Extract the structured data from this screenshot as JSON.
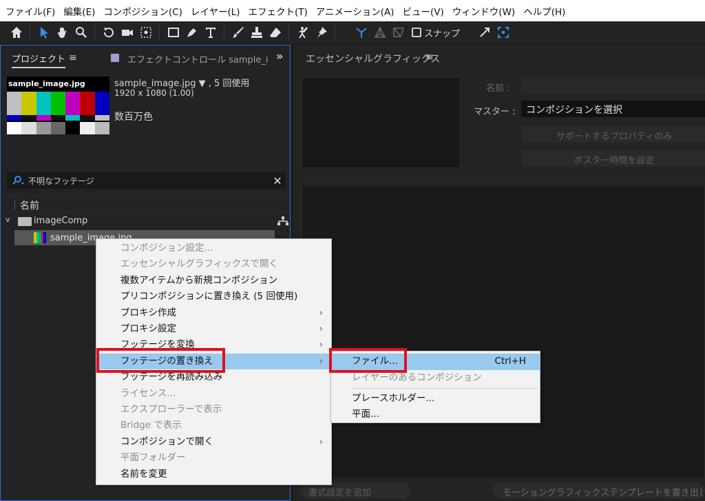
{
  "menubar": [
    "ファイル(F)",
    "編集(E)",
    "コンポジション(C)",
    "レイヤー(L)",
    "エフェクト(T)",
    "アニメーション(A)",
    "ビュー(V)",
    "ウィンドウ(W)",
    "ヘルプ(H)"
  ],
  "toolbar": {
    "tools": [
      "home-icon",
      "selection-arrow-icon",
      "hand-icon",
      "zoom-icon",
      "rotate-icon",
      "camera-icon",
      "pan-behind-icon",
      "rectangle-icon",
      "pen-icon",
      "text-icon",
      "brush-icon",
      "clone-stamp-icon",
      "eraser-icon",
      "roto-brush-icon",
      "puppet-pin-icon"
    ],
    "snap_label": "スナップ",
    "accent": "#3a8ee6"
  },
  "project": {
    "tab_label": "プロジェクト",
    "effect_tab_label": "エフェクトコントロール sample_i",
    "thumb_label": "sample_image.jpg",
    "file_line1": "sample_image.jpg ▼ , 5 回使用",
    "file_line2": "1920 x 1080 (1.00)",
    "file_line3": "数百万色",
    "search_value": "不明なフッテージ",
    "column_name": "名前",
    "folder_name": "imageComp",
    "item_name": "sample_image.jpg"
  },
  "essential": {
    "title": "エッセンシャルグラフィックス",
    "name_label": "名前 :",
    "master_label": "マスター :",
    "master_value": "コンポジションを選択",
    "button1": "サポートするプロパティのみ",
    "button2": "ポスター時間を設定",
    "bottom_left": "書式設定を追加",
    "bottom_right": "モーショングラフィックステンプレートを書き出し..."
  },
  "context_menu": {
    "items": [
      {
        "label": "コンポジション設定...",
        "disabled": true,
        "submenu": false
      },
      {
        "label": "エッセンシャルグラフィックスで開く",
        "disabled": true,
        "submenu": false
      },
      {
        "label": "複数アイテムから新規コンポジション",
        "disabled": false,
        "submenu": false
      },
      {
        "label": "プリコンポジションに置き換え (5 回使用)",
        "disabled": false,
        "submenu": false
      },
      {
        "label": "プロキシ作成",
        "disabled": false,
        "submenu": true
      },
      {
        "label": "プロキシ設定",
        "disabled": false,
        "submenu": true
      },
      {
        "label": "フッテージを変換",
        "disabled": false,
        "submenu": true
      },
      {
        "label": "フッテージの置き換え",
        "disabled": false,
        "submenu": true,
        "highlighted": true
      },
      {
        "label": "フッテージを再読み込み",
        "disabled": false,
        "submenu": false
      },
      {
        "label": "ライセンス...",
        "disabled": true,
        "submenu": false
      },
      {
        "label": "エクスプローラーで表示",
        "disabled": true,
        "submenu": false
      },
      {
        "label": "Bridge で表示",
        "disabled": true,
        "submenu": false
      },
      {
        "label": "コンポジションで開く",
        "disabled": false,
        "submenu": true
      },
      {
        "label": "平面フォルダー",
        "disabled": true,
        "submenu": false
      },
      {
        "label": "名前を変更",
        "disabled": false,
        "submenu": false
      }
    ]
  },
  "submenu": {
    "items": [
      {
        "label": "ファイル...",
        "shortcut": "Ctrl+H",
        "highlighted": true,
        "disabled": false
      },
      {
        "label": "レイヤーのあるコンポジション",
        "shortcut": "",
        "disabled": true
      },
      {
        "label": "プレースホルダー...",
        "shortcut": "",
        "disabled": false
      },
      {
        "label": "平面...",
        "shortcut": "",
        "disabled": false
      }
    ]
  },
  "highlight_color": "#e0101a"
}
